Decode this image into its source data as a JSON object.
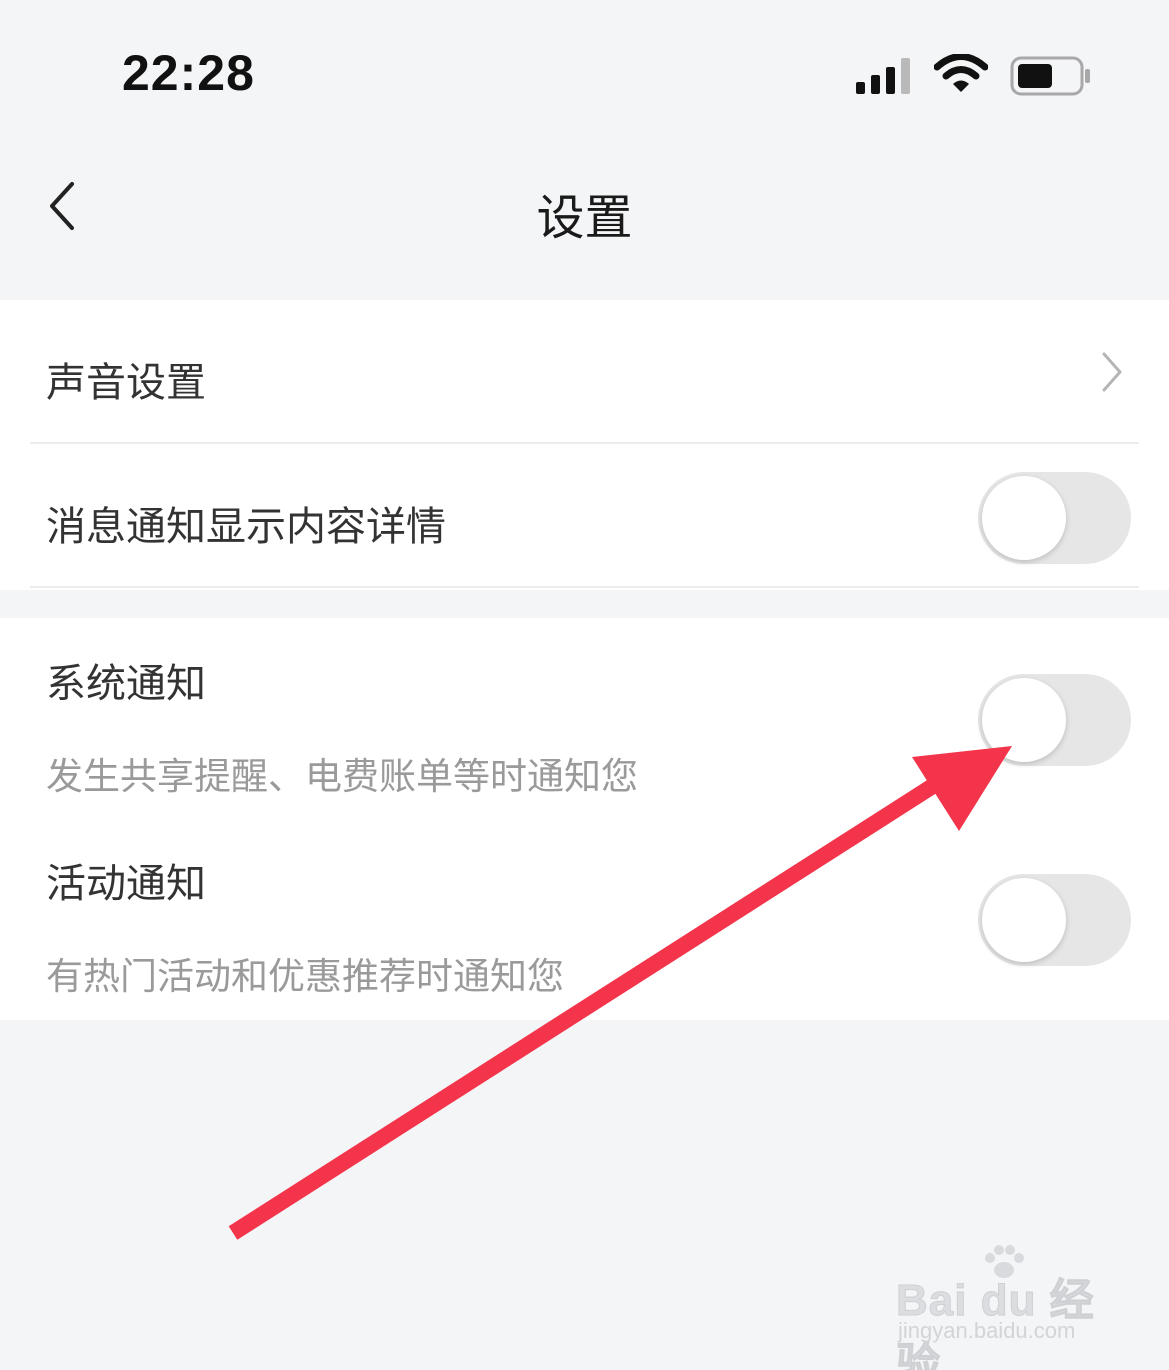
{
  "status_bar": {
    "time": "22:28",
    "icons": [
      "signal-icon",
      "wifi-icon",
      "battery-icon"
    ]
  },
  "nav": {
    "title": "设置",
    "back_icon": "chevron-left-icon"
  },
  "groups": [
    {
      "items": [
        {
          "label": "声音设置",
          "control": "chevron-right-icon"
        },
        {
          "label": "消息通知显示内容详情",
          "control": "toggle",
          "on": false
        }
      ]
    },
    {
      "items": [
        {
          "label": "系统通知",
          "subtitle": "发生共享提醒、电费账单等时通知您",
          "control": "toggle",
          "on": false
        },
        {
          "label": "活动通知",
          "subtitle": "有热门活动和优惠推荐时通知您",
          "control": "toggle",
          "on": false
        }
      ]
    }
  ],
  "annotation": {
    "arrow_color": "#f3344a",
    "points_to": "系统通知"
  },
  "watermark": {
    "brand": "Bai du 经验",
    "url": "jingyan.baidu.com"
  },
  "colors": {
    "background": "#f4f5f7",
    "card": "#ffffff",
    "toggle_off_track": "#e6e6e6",
    "subtitle_text": "#9a9a9a"
  }
}
